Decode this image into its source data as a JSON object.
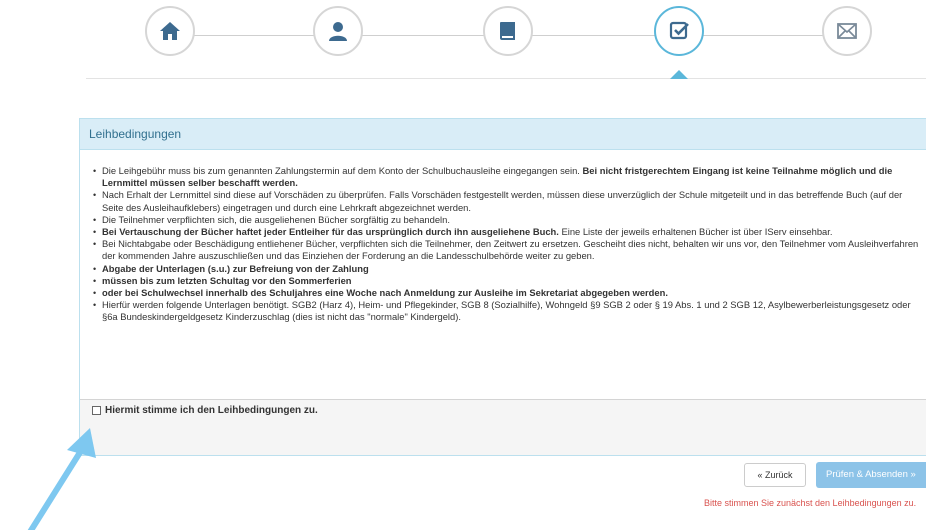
{
  "stepper": {
    "steps": [
      {
        "icon": "home-icon",
        "state": "done"
      },
      {
        "icon": "user-icon",
        "state": "done"
      },
      {
        "icon": "book-icon",
        "state": "done"
      },
      {
        "icon": "check-square-icon",
        "state": "active"
      },
      {
        "icon": "envelope-icon",
        "state": "todo"
      }
    ]
  },
  "panel": {
    "heading": "Leihbedingungen",
    "terms": [
      {
        "text": "Die Leihgebühr muss bis zum genannten Zahlungstermin auf dem Konto der Schulbuchausleihe eingegangen sein. ",
        "bold_tail": "Bei nicht fristgerechtem Eingang ist keine Teilnahme möglich und die Lernmittel müssen selber beschafft werden."
      },
      {
        "text": "Nach Erhalt der Lernmittel sind diese auf Vorschäden zu überprüfen. Falls Vorschäden festgestellt werden, müssen diese unverzüglich der Schule mitgeteilt und in das betreffende Buch (auf der Seite des Ausleihaufklebers) eingetragen und durch eine Lehrkraft abgezeichnet werden."
      },
      {
        "text": "Die Teilnehmer verpflichten sich, die ausgeliehenen Bücher sorgfältig zu behandeln."
      },
      {
        "bold_head": "Bei Vertauschung der Bücher haftet jeder Entleiher für das ursprünglich durch ihn ausgeliehene Buch.",
        "text": " Eine Liste der jeweils erhaltenen Bücher ist über IServ einsehbar."
      },
      {
        "text": "Bei Nichtabgabe oder Beschädigung entliehener Bücher, verpflichten sich die Teilnehmer, den Zeitwert zu ersetzen. Gescheiht dies nicht, behalten wir uns vor, den Teilnehmer vom Ausleihverfahren der kommenden Jahre auszuschließen und das Einziehen der Forderung an die Landesschulbehörde weiter zu geben."
      },
      {
        "bold_head": "Abgabe der Unterlagen (s.u.) zur Befreiung von der Zahlung"
      },
      {
        "bold_head": "müssen bis zum letzten Schultag vor den Sommerferien"
      },
      {
        "bold_head": "oder bei Schulwechsel innerhalb des Schuljahres eine Woche nach Anmeldung zur Ausleihe im Sekretariat abgegeben werden."
      },
      {
        "text": "Hierfür werden folgende Unterlagen benötigt. SGB2 (Harz 4), Heim- und Pflegekinder, SGB 8 (Sozialhilfe), Wohngeld §9 SGB 2 oder § 19 Abs. 1 und 2 SGB 12, Asylbewerberleistungsgesetz oder §6a Bundeskindergeldgesetz Kinderzuschlag (dies ist nicht das \"normale\" Kindergeld)."
      }
    ],
    "agree_label": "Hiermit stimme ich den Leihbedingungen zu.",
    "agree_checked": false
  },
  "buttons": {
    "back_label": "« Zurück",
    "submit_label": "Prüfen & Absenden »"
  },
  "error_text": "Bitte stimmen Sie zunächst den Leihbedingungen zu.",
  "colors": {
    "accent": "#5bb7da",
    "step_icon": "#3d6a8f",
    "panel_heading_bg": "#d9edf7",
    "submit_bg": "#8cc3e8",
    "error": "#d9534f",
    "annotation_arrow": "#7ec8f0"
  }
}
